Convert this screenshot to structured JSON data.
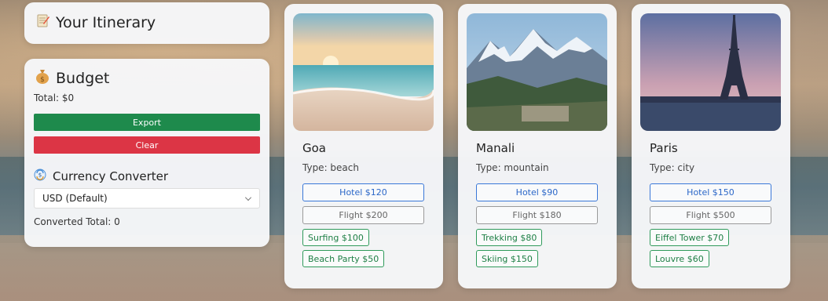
{
  "itinerary": {
    "title": "Your Itinerary"
  },
  "budget": {
    "title": "Budget",
    "total": "Total: $0",
    "export_label": "Export",
    "clear_label": "Clear",
    "currency_title": "Currency Converter",
    "currency_selected": "USD (Default)",
    "converted_total": "Converted Total: 0"
  },
  "destinations": [
    {
      "name": "Goa",
      "type": "Type: beach",
      "hotel": "Hotel $120",
      "flight": "Flight $200",
      "activities": [
        "Surfing $100",
        "Beach Party $50"
      ]
    },
    {
      "name": "Manali",
      "type": "Type: mountain",
      "hotel": "Hotel $90",
      "flight": "Flight $180",
      "activities": [
        "Trekking $80",
        "Skiing $150"
      ]
    },
    {
      "name": "Paris",
      "type": "Type: city",
      "hotel": "Hotel $150",
      "flight": "Flight $500",
      "activities": [
        "Eiffel Tower $70",
        "Louvre $60"
      ]
    }
  ],
  "icons": {
    "itinerary": "memo-icon",
    "budget": "money-bag-icon",
    "currency": "currency-exchange-icon",
    "select": "chevron-down-icon"
  },
  "colors": {
    "export": "#1e8a4c",
    "clear": "#dc3545",
    "hotel": "#3a78d8",
    "activity": "#2f9a5b"
  }
}
